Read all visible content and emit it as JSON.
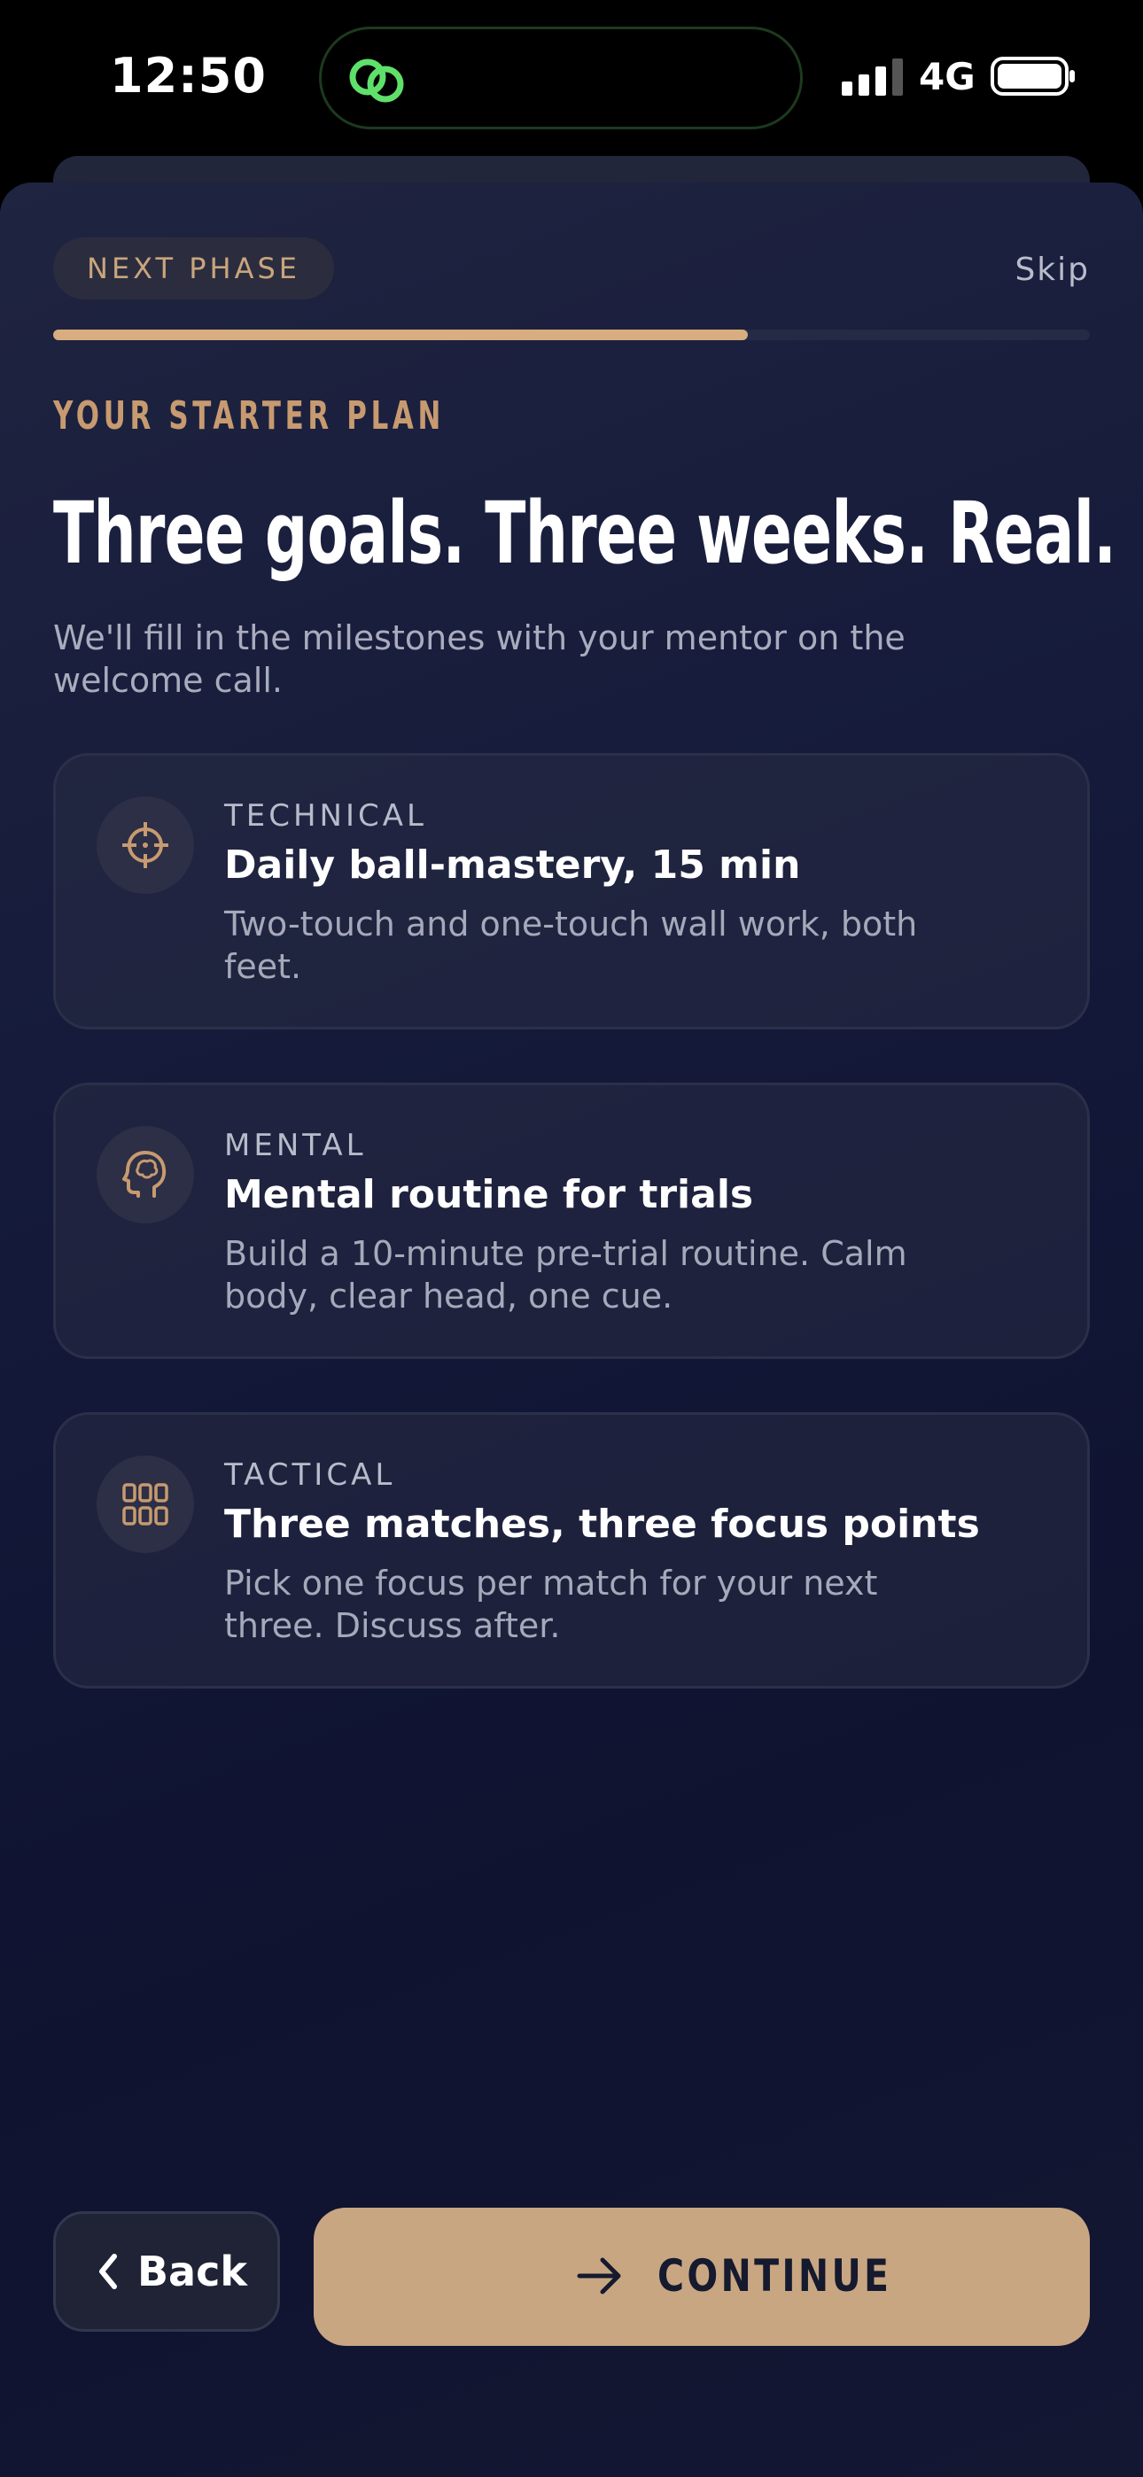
{
  "status_bar": {
    "time": "12:50",
    "network": "4G",
    "island_icon": "link-rings-icon",
    "island_accent": "#5fe06a"
  },
  "header": {
    "phase_pill": "NEXT PHASE",
    "skip_label": "Skip",
    "progress_fraction": 0.67
  },
  "intro": {
    "eyebrow": "YOUR STARTER PLAN",
    "headline": "Three goals. Three weeks. Real.",
    "subtitle": "We'll fill in the milestones with your mentor on the welcome call."
  },
  "goals": [
    {
      "category": "TECHNICAL",
      "title": "Daily ball-mastery, 15 min",
      "description": "Two-touch and one-touch wall work, both feet.",
      "icon": "crosshair-icon"
    },
    {
      "category": "MENTAL",
      "title": "Mental routine for trials",
      "description": "Build a 10-minute pre-trial routine. Calm body, clear head, one cue.",
      "icon": "brain-head-icon"
    },
    {
      "category": "TACTICAL",
      "title": "Three matches, three focus points",
      "description": "Pick one focus per match for your next three. Discuss after.",
      "icon": "grid-icon"
    }
  ],
  "footer": {
    "back_label": "Back",
    "continue_label": "CONTINUE"
  },
  "colors": {
    "accent": "#c9a682",
    "accent_text": "#c79a70",
    "background": "#141935"
  }
}
